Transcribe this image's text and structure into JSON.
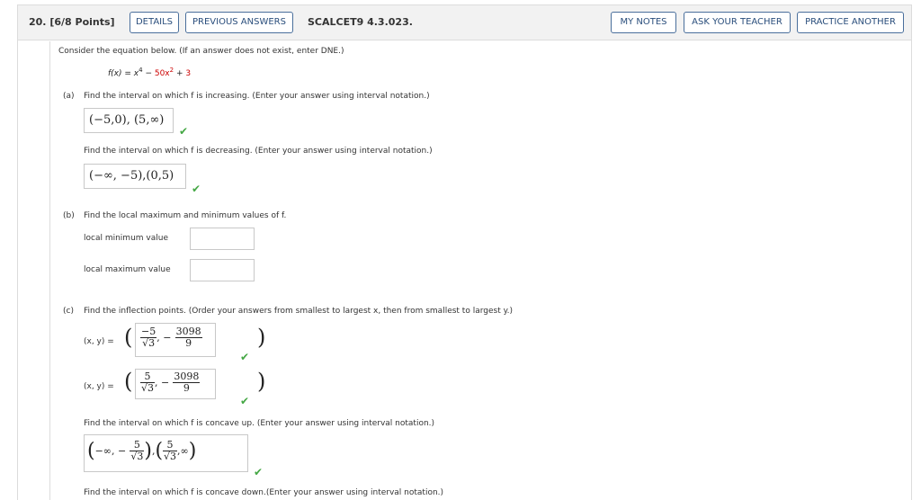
{
  "header": {
    "question_number": "20.",
    "points": "[6/8 Points]",
    "details_btn": "DETAILS",
    "prev_answers_btn": "PREVIOUS ANSWERS",
    "question_id": "SCALCET9 4.3.023.",
    "my_notes_btn": "MY NOTES",
    "ask_teacher_btn": "ASK YOUR TEACHER",
    "practice_btn": "PRACTICE ANOTHER"
  },
  "prompt": "Consider the equation below. (If an answer does not exist, enter DNE.)",
  "equation": {
    "lhs": "f(x) = x",
    "exp4": "4",
    "minus": " − ",
    "term2": "50x",
    "exp2": "2",
    "plus": " + ",
    "const": "3"
  },
  "part_a": {
    "label": "(a)",
    "increasing_q": "Find the interval on which f is increasing. (Enter your answer using interval notation.)",
    "increasing_ans": "(−5,0), (5,∞)",
    "decreasing_q": "Find the interval on which f is decreasing. (Enter your answer using interval notation.)",
    "decreasing_ans": "(−∞, −5),(0,5)"
  },
  "part_b": {
    "label": "(b)",
    "question": "Find the local maximum and minimum values of f.",
    "min_label": "local minimum value",
    "max_label": "local maximum value",
    "min_value": "",
    "max_value": ""
  },
  "part_c": {
    "label": "(c)",
    "question": "Find the inflection points. (Order your answers from smallest to largest x, then from smallest to largest y.)",
    "xy_label": "(x, y) =",
    "pt1": {
      "x_num": "−5",
      "x_den": "√3",
      "y_sign": "−",
      "y_num": "3098",
      "y_den": "9"
    },
    "pt2": {
      "x_num": "5",
      "x_den": "√3",
      "y_sign": "−",
      "y_num": "3098",
      "y_den": "9"
    },
    "concave_up_q": "Find the interval on which f is concave up. (Enter your answer using interval notation.)",
    "cu_left": "−∞, −",
    "cu_f1_num": "5",
    "cu_f1_den": "√3",
    "cu_f2_num": "5",
    "cu_f2_den": "√3",
    "cu_right": ",∞",
    "concave_down_q": "Find the interval on which f is concave down.(Enter your answer using interval notation.)"
  },
  "icons": {
    "correct": "check-icon"
  },
  "colors": {
    "accent": "#2a4e7c",
    "correct": "#44a744",
    "highlight": "#cc0000"
  }
}
